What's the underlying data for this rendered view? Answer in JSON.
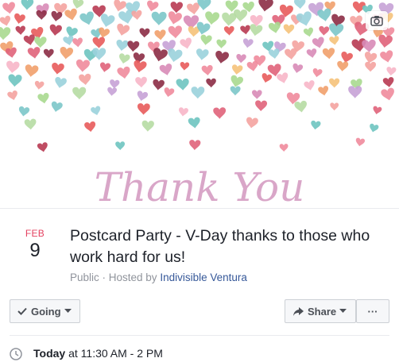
{
  "cover": {
    "caption": "Thank You",
    "heart_colors": [
      "#e0637a",
      "#f08b9c",
      "#f4a3a0",
      "#b83a52",
      "#8c2c45",
      "#9ad2dc",
      "#7cc7c9",
      "#a9d98f",
      "#f5c27a",
      "#f1a06b",
      "#d88bb7",
      "#c7a2d6",
      "#f7b6c8",
      "#e85b5b",
      "#6ec4c0",
      "#b6dca3"
    ],
    "caption_color": "#d9a6c8"
  },
  "event": {
    "month": "FEB",
    "day": "9",
    "title": "Postcard Party - V-Day thanks to those who work hard for us!",
    "privacy": "Public",
    "hosted_prefix": " · Hosted by ",
    "host": "Indivisible Ventura"
  },
  "actions": {
    "going_label": "Going",
    "share_label": "Share",
    "more_label": "···"
  },
  "details": {
    "time_day": "Today",
    "time_range": " at 11:30 AM - 2 PM"
  }
}
